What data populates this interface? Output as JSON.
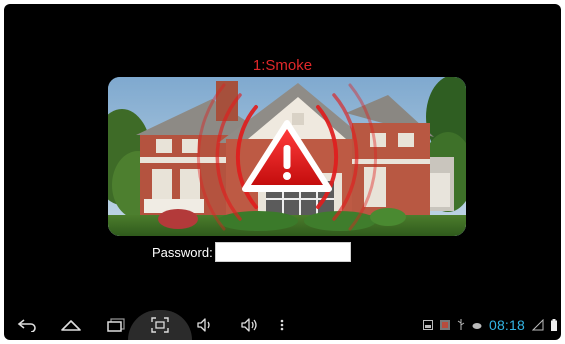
{
  "alarm": {
    "title": "1:Smoke",
    "icon": "warning-triangle-icon",
    "accent_color": "#e0282a"
  },
  "password": {
    "label": "Password:",
    "value": ""
  },
  "navbar": {
    "buttons": [
      "back-icon",
      "home-icon",
      "recent-apps-icon",
      "screenshot-icon",
      "volume-down-icon",
      "volume-up-icon",
      "menu-icon"
    ]
  },
  "statusbar": {
    "time": "08:18",
    "time_color": "#33b5e5",
    "icons": [
      "gallery-icon",
      "app-icon",
      "usb-icon",
      "debug-icon",
      "signal-icon",
      "battery-icon"
    ]
  }
}
